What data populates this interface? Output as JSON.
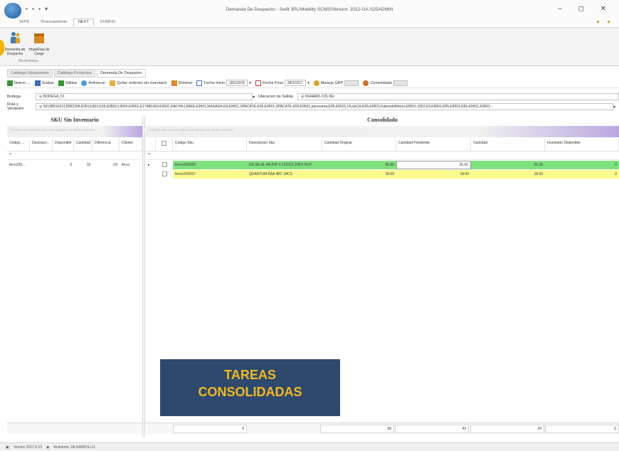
{
  "window": {
    "title": "Demanda De Despacho - Swift 3PL/Mobility SCMS/Version: 2012-GA-S25ADMIN",
    "ribbon_tabs": [
      "SFPE",
      "Procesamiento",
      "NEXT",
      "CONFIG"
    ],
    "active_ribbon_tab": 2
  },
  "ribbon": {
    "buttons": [
      {
        "label": "Demanda de Despacho"
      },
      {
        "label": "Hoja/Ruta de Carga"
      }
    ],
    "group_label": "Movimientos"
  },
  "doc_tabs": [
    "Catálogo Ubicaciones",
    "Catálogo Productos",
    "Demanda De Despacho"
  ],
  "toolbar": {
    "nuevo": "Nuevo",
    "grabar": "Grabar",
    "validar": "Validar",
    "refrescar": "Refrescar",
    "quitar": "Quitar ordenes sin inventario",
    "eliminar": "Eliminar",
    "fecha_inicio_label": "Fecha Inicio",
    "fecha_inicio": "18/1/2016",
    "fecha_final_label": "Fecha Final",
    "fecha_final": "28/1/2017",
    "maneja_grp": "Maneja GRP",
    "consolidado": "Consolidado"
  },
  "fields": {
    "bodega_label": "Bodega",
    "bodega_value": "BODEGA_01",
    "ubicacion_label": "Ubicacion de Salida",
    "ubicacion_value": "0044AM1-C01-NU",
    "ruta_label": "Ruta y Vendedor",
    "ruta_value": "0013851E911,8002305,E9013,8011105,E95013,9005,E9501,E174861E9,E9501,RACHA,LIMEE,E9501,MASAGA,E9,E9501,SPACATE,E95,E9501,SPACATE,E95,E9501,panorama,E95,E9501,LA,daCA,E95,E9501,Fabriodoffinicio,E9501,3352,E9,E9501,E95,E9501,E95,E9501,E9501..."
  },
  "left_panel": {
    "title": "SKU Sin Inventario",
    "group_hint": "Arrastre una columna aquí para agrupar por dicha columna",
    "columns": [
      "Código ...",
      "Descripci...",
      "Disponible",
      "Cantidad",
      "Diferencia",
      "Cliente"
    ],
    "rows": [
      {
        "codigo": "ferco/20...",
        "descripcion": "",
        "disponible": "0",
        "cantidad": "18",
        "diferencia": "-18",
        "cliente": "ferco"
      }
    ],
    "filter_glyph": "▾"
  },
  "right_panel": {
    "title": "Consolidado",
    "group_hint": "Arrastre una columna aquí para agrupar por dicha columna",
    "columns": [
      "Código Sku",
      "Descripción Sku",
      "Cantidad Original",
      "Cantidad Pendiente",
      "Cantidad",
      "Inventario Disponible"
    ],
    "rows": [
      {
        "codigo": "ferco/100002",
        "descripcion": "DU DE AL 4A 20P X 12OCS 2SFX HUY",
        "original": "50.00",
        "pendiente": "25.00",
        "cantidad": "25.00",
        "inventario": "0",
        "color": "#7ee07e"
      },
      {
        "codigo": "ferco/100017",
        "descripcion": "QUANTUM AAA 4BC 04CS",
        "original": "18.00",
        "pendiente": "18.00",
        "cantidad": "18.00",
        "inventario": "0",
        "color": "#fbfb8e"
      }
    ]
  },
  "footer_totals": [
    "0",
    "68",
    "43",
    "43",
    "0"
  ],
  "status": {
    "version": "Version 2017.6.15",
    "ambiente": "Ambiente: DESARROLLO"
  },
  "banner": {
    "line1": "TAREAS",
    "line2": "CONSOLIDADAS"
  },
  "colors": {
    "accent": "#2d4a6e",
    "banner_text": "#f5b820",
    "row_green": "#7ee07e",
    "row_yellow": "#fbfb8e"
  }
}
